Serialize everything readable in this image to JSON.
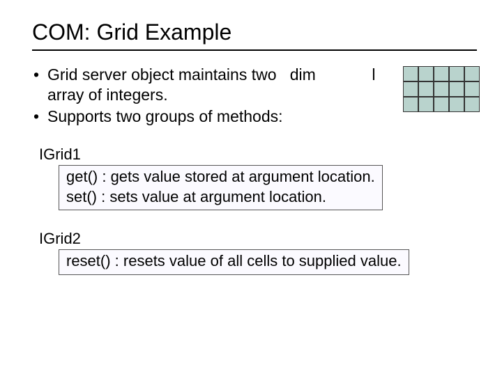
{
  "title": "COM: Grid Example",
  "bullets": {
    "b1a": "Grid server object maintains two",
    "b1b": "dim",
    "b1c": "l",
    "b1d": "array of integers.",
    "b2": "Supports two groups of methods:"
  },
  "groups": {
    "g1": {
      "name": "IGrid1",
      "m1": "get() : gets value stored at argument location.",
      "m2": "set() : sets value at argument location."
    },
    "g2": {
      "name": "IGrid2",
      "m1": "reset() : resets value of all cells to supplied value."
    }
  }
}
